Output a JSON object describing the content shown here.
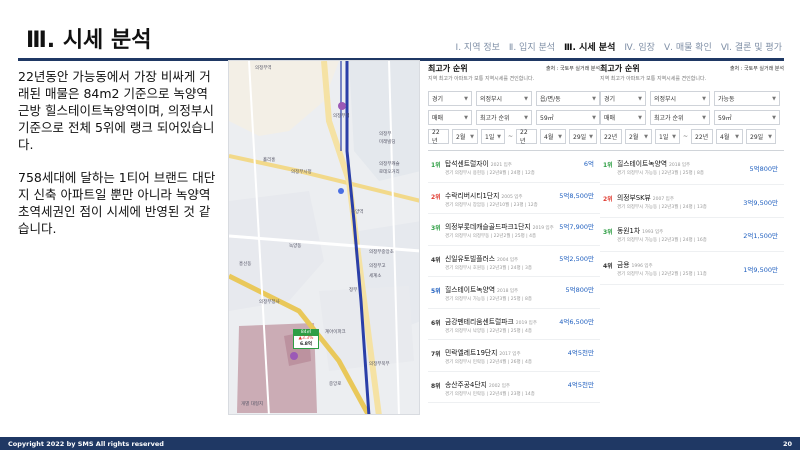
{
  "slide": {
    "title": "Ⅲ. 시세 분석",
    "nav": [
      "Ⅰ. 지역 정보",
      "Ⅱ. 입지 분석",
      "Ⅲ. 시세 분석",
      "Ⅳ. 임장",
      "Ⅴ. 매물 확인",
      "Ⅵ. 결론 및 평가"
    ],
    "active_nav_index": 2,
    "paragraphs": [
      "22년동안 가능동에서 가장 비싸게 거래된 매물은 84m2 기준으로 녹양역 근방 힐스테이트녹양역이며, 의정부시 기준으로 전체 5위에 랭크 되어있습니다.",
      "758세대에 달하는 1티어 브랜드 대단지 신축 아파트일 뿐만 아니라 녹양역 초역세권인 점이 시세에 반영된 것 같습니다."
    ],
    "footer_left": "Copyright 2022 by SMS All rights reserved",
    "page_number": "20"
  },
  "map": {
    "labels": [
      "의정부역",
      "의정부역",
      "의정부",
      "미래빌딩",
      "의정부캐슬",
      "로데오거리",
      "홀리홍",
      "의정부시청",
      "녹양역",
      "의정부중앙초",
      "의정부고",
      "세계소",
      "정부",
      "계아이파크",
      "녹양동",
      "흥선동",
      "의정부북부",
      "중앙로",
      "의정부청사",
      "개별 대형지"
    ],
    "marker_label": "84㎡",
    "marker_change": "▲3.3%",
    "marker_price": "6.8억"
  },
  "panel1": {
    "title": "최고가 순위",
    "source": "출처 : 국토부 실거래 분석",
    "desc": "지역 최고가 아파트가 보통 지역시세를 견인합니다.",
    "row1": [
      "경기",
      "의정부시",
      "읍/면/동"
    ],
    "row2": [
      "매매",
      "최고가 순위",
      "59㎡"
    ],
    "row3": [
      "22년",
      "2월",
      "1일",
      "~",
      "22년",
      "4월",
      "29일"
    ],
    "items": [
      {
        "rank": "1위",
        "color": "green",
        "name": "탑석센트럴자이",
        "year": "2021 입주",
        "info": "경기 의정부시 용현동 | 22년8월 | 24평 | 12층",
        "price": "6억"
      },
      {
        "rank": "2위",
        "color": "red",
        "name": "수락리버시티1단지",
        "year": "2005 입주",
        "info": "경기 의정부시 장암동 | 22년10월 | 23평 | 12층",
        "price": "5억8,500만"
      },
      {
        "rank": "3위",
        "color": "green",
        "name": "의정부롯데캐슬골드파크1단지",
        "year": "2019 입주",
        "info": "경기 의정부시 의정부동 | 22년2월 | 25평 | 4층",
        "price": "5억7,900만"
      },
      {
        "rank": "4위",
        "color": "dark",
        "name": "신일유토빌플러스",
        "year": "2004 입주",
        "info": "경기 의정부시 호원동 | 22년3월 | 24평 | 3층",
        "price": "5억2,500만"
      },
      {
        "rank": "5위",
        "color": "blue",
        "name": "힐스테이트녹양역",
        "year": "2018 입주",
        "info": "경기 의정부시 가능동 | 22년3월 | 25평 | 8층",
        "price": "5억800만"
      },
      {
        "rank": "6위",
        "color": "dark",
        "name": "금강펜테리움센트럴파크",
        "year": "2019 입주",
        "info": "경기 의정부시 낙양동 | 22년2월 | 25평 | 4층",
        "price": "4억6,500만"
      },
      {
        "rank": "7위",
        "color": "dark",
        "name": "민락엘레트19단지",
        "year": "2017 입주",
        "info": "경기 의정부시 민락동 | 22년4월 | 26평 | 4층",
        "price": "4억5천만"
      },
      {
        "rank": "8위",
        "color": "dark",
        "name": "송산주공4단지",
        "year": "2002 입주",
        "info": "경기 의정부시 민락동 | 22년4월 | 23평 | 14층",
        "price": "4억5천만"
      }
    ]
  },
  "panel2": {
    "title": "최고가 순위",
    "source": "출처 : 국토부 실거래 분석",
    "desc": "지역 최고가 아파트가 보통 지역시세를 견인합니다.",
    "row1": [
      "경기",
      "의정부시",
      "가능동"
    ],
    "row2": [
      "매매",
      "최고가 순위",
      "59㎡"
    ],
    "row3": [
      "22년",
      "2월",
      "1일",
      "~",
      "22년",
      "4월",
      "29일"
    ],
    "items": [
      {
        "rank": "1위",
        "color": "green",
        "name": "힐스테이트녹양역",
        "year": "2018 입주",
        "info": "경기 의정부시 가능동 | 22년3월 | 25평 | 8층",
        "price": "5억800만"
      },
      {
        "rank": "2위",
        "color": "red",
        "name": "의정부SK뷰",
        "year": "2007 입주",
        "info": "경기 의정부시 가능동 | 22년3월 | 24평 | 13층",
        "price": "3억9,500만"
      },
      {
        "rank": "3위",
        "color": "green",
        "name": "동원1차",
        "year": "1993 입주",
        "info": "경기 의정부시 가능동 | 22년3월 | 24평 | 16층",
        "price": "2억1,500만"
      },
      {
        "rank": "4위",
        "color": "dark",
        "name": "금용",
        "year": "1996 입주",
        "info": "경기 의정부시 가능동 | 22년2월 | 25평 | 11층",
        "price": "1억9,500만"
      }
    ]
  }
}
